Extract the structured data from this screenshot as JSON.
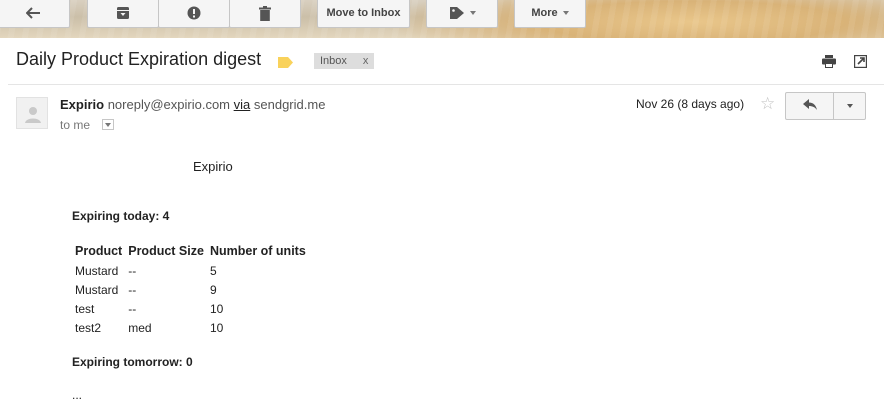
{
  "toolbar": {
    "move_to_inbox_label": "Move to Inbox",
    "more_label": "More",
    "icons": [
      "back-arrow-icon",
      "archive-icon",
      "report-spam-icon",
      "delete-icon",
      "label-icon"
    ]
  },
  "message": {
    "subject": "Daily Product Expiration digest",
    "label_chip": {
      "text": "Inbox",
      "remove": "x"
    },
    "sender_name": "Expirio",
    "sender_email": "noreply@expirio.com",
    "via_label": "via",
    "via_domain": "sendgrid.me",
    "recipient": "to me",
    "date": "Nov 26 (8 days ago)"
  },
  "email_body": {
    "brand": "Expirio",
    "expiring_today": "Expiring today: 4",
    "table": {
      "headers": [
        "Product",
        "Product Size",
        "Number of units"
      ],
      "rows": [
        [
          "Mustard",
          "--",
          "5"
        ],
        [
          "Mustard",
          "--",
          "9"
        ],
        [
          "test",
          "--",
          "10"
        ],
        [
          "test2",
          "med",
          "10"
        ]
      ]
    },
    "expiring_tomorrow": "Expiring tomorrow: 0",
    "ellipsis": "..."
  },
  "colors": {
    "label_tag": "#f9d25b",
    "chip_bg": "#dddddd",
    "button_bg": "#f5f5f5",
    "star": "#c2c2c2"
  }
}
